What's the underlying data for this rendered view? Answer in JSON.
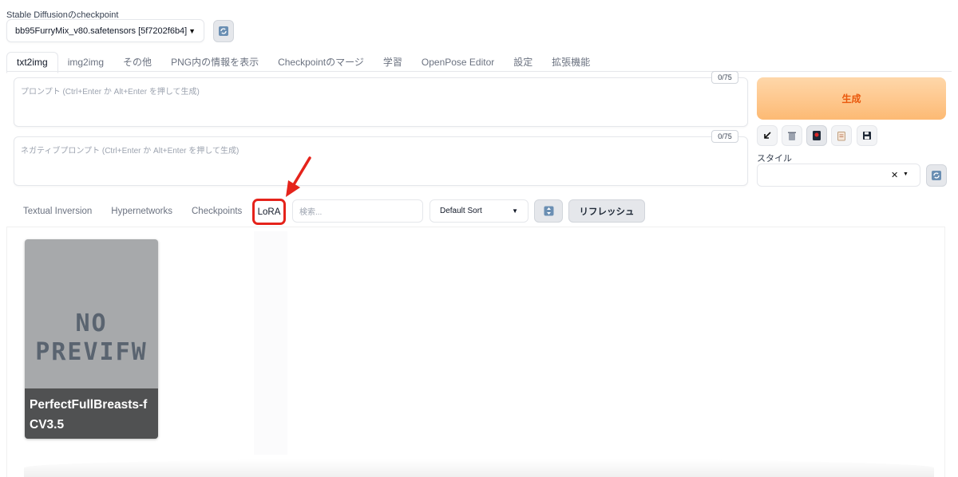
{
  "checkpoint": {
    "label": "Stable Diffusionのcheckpoint",
    "selected": "bb95FurryMix_v80.safetensors [5f7202f6b4]"
  },
  "tabs": [
    {
      "label": "txt2img",
      "active": true
    },
    {
      "label": "img2img"
    },
    {
      "label": "その他"
    },
    {
      "label": "PNG内の情報を表示"
    },
    {
      "label": "Checkpointのマージ"
    },
    {
      "label": "学習"
    },
    {
      "label": "OpenPose Editor"
    },
    {
      "label": "設定"
    },
    {
      "label": "拡張機能"
    }
  ],
  "prompt": {
    "placeholder": "プロンプト (Ctrl+Enter か Alt+Enter を押して生成)",
    "counter": "0/75"
  },
  "negative_prompt": {
    "placeholder": "ネガティブプロンプト (Ctrl+Enter か Alt+Enter を押して生成)",
    "counter": "0/75"
  },
  "generate_label": "生成",
  "style": {
    "label": "スタイル"
  },
  "extra_networks": {
    "tabs": [
      "Textual Inversion",
      "Hypernetworks",
      "Checkpoints"
    ],
    "lora_tab": "LoRA",
    "search_placeholder": "検索...",
    "sort": "Default Sort",
    "refresh_label": "リフレッシュ"
  },
  "cards": [
    {
      "name": "PerfectFullBreasts-fCV3.5",
      "preview_line1": "NO",
      "preview_line2": "PREVIFW"
    }
  ],
  "colors": {
    "annotation_red": "#e5231b",
    "generate_text": "#ea580c"
  }
}
